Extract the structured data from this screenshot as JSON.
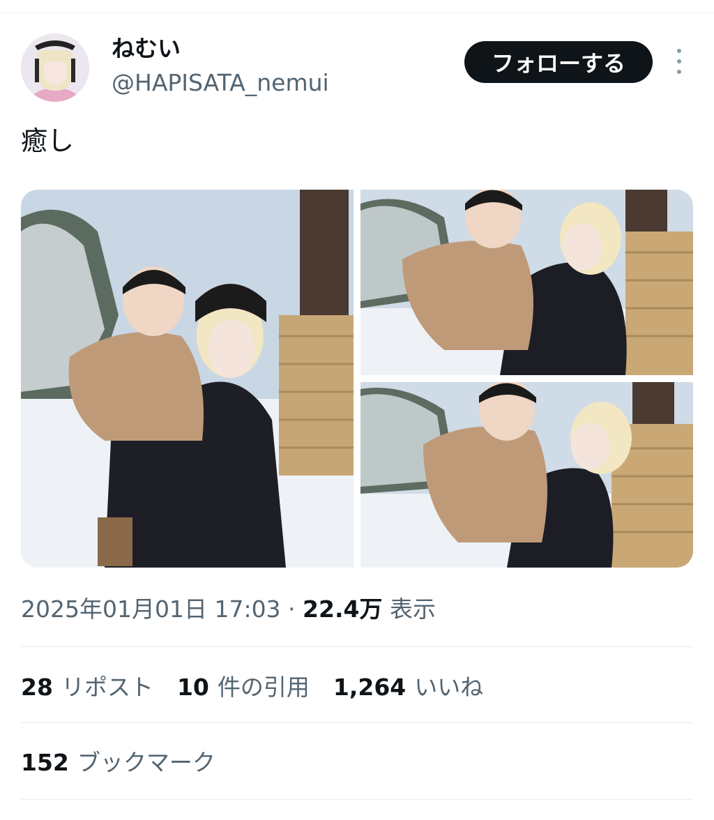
{
  "user": {
    "display_name": "ねむい",
    "handle": "@HAPISATA_nemui"
  },
  "follow_button": "フォローする",
  "tweet": {
    "text": "癒し"
  },
  "meta": {
    "timestamp": "2025年01月01日 17:03",
    "separator": " · ",
    "views_count": "22.4万",
    "views_label": "表示"
  },
  "stats": {
    "reposts": {
      "count": "28",
      "label": "リポスト"
    },
    "quotes": {
      "count": "10",
      "label": "件の引用"
    },
    "likes": {
      "count": "1,264",
      "label": "いいね"
    },
    "bookmarks": {
      "count": "152",
      "label": "ブックマーク"
    }
  },
  "colors": {
    "text_primary": "#0f1419",
    "text_secondary": "#536471",
    "follow_bg": "#0f1419",
    "divider": "#e6ecf0"
  },
  "icons": [
    "more-options-icon"
  ]
}
